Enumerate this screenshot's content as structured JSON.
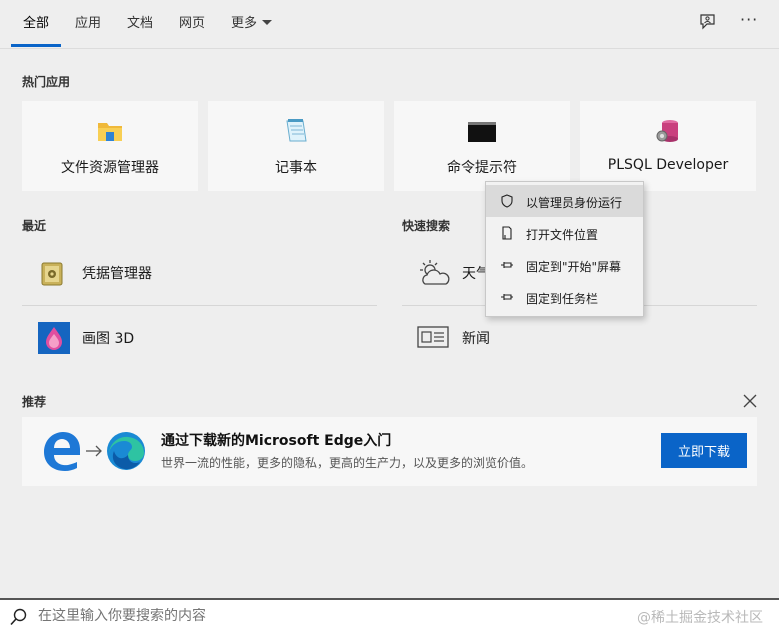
{
  "tabs": [
    {
      "label": "全部"
    },
    {
      "label": "应用"
    },
    {
      "label": "文档"
    },
    {
      "label": "网页"
    },
    {
      "label": "更多"
    }
  ],
  "top_icons": {
    "feedback": "feedback-icon",
    "more": "···"
  },
  "hot_apps": {
    "title": "热门应用",
    "items": [
      {
        "label": "文件资源管理器",
        "icon": "folder-icon"
      },
      {
        "label": "记事本",
        "icon": "notepad-icon"
      },
      {
        "label": "命令提示符",
        "icon": "cmd-icon"
      },
      {
        "label": "PLSQL Developer",
        "icon": "plsql-icon"
      }
    ]
  },
  "recent": {
    "title": "最近",
    "items": [
      {
        "label": "凭据管理器",
        "icon": "credential-icon"
      },
      {
        "label": "画图 3D",
        "icon": "paint3d-icon"
      }
    ]
  },
  "quick_search": {
    "title": "快速搜索",
    "items": [
      {
        "label": "天气",
        "icon": "weather-icon"
      },
      {
        "label": "新闻",
        "icon": "news-icon"
      }
    ]
  },
  "context_menu": {
    "items": [
      {
        "label": "以管理员身份运行",
        "icon": "shield-icon"
      },
      {
        "label": "打开文件位置",
        "icon": "file-location-icon"
      },
      {
        "label": "固定到\"开始\"屏幕",
        "icon": "pin-icon"
      },
      {
        "label": "固定到任务栏",
        "icon": "pin-icon"
      }
    ]
  },
  "recommend": {
    "title": "推荐",
    "banner_title": "通过下载新的Microsoft Edge入门",
    "banner_sub": "世界一流的性能，更多的隐私，更高的生产力，以及更多的浏览价值。",
    "cta": "立即下载"
  },
  "search": {
    "placeholder": "在这里输入你要搜索的内容",
    "watermark": "@稀土掘金技术社区"
  },
  "colors": {
    "accent": "#0a64c8",
    "background": "#eeeeee"
  }
}
